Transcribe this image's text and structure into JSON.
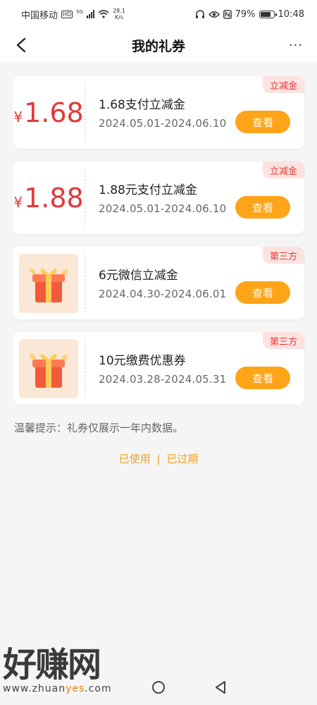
{
  "statusbar": {
    "carrier": "中国移动",
    "hd": "HD",
    "signal": "5G",
    "net_speed_value": "28.1",
    "net_speed_unit": "K/s",
    "battery": "79%",
    "battery_level": 0.79,
    "time": "10:48"
  },
  "navbar": {
    "title": "我的礼券",
    "more": "···"
  },
  "coupons": [
    {
      "currency": "¥",
      "amount": "1.68",
      "title": "1.68支付立减金",
      "dates": "2024.05.01-2024.06.10",
      "button": "查看",
      "tag": "立减金",
      "image": ""
    },
    {
      "currency": "¥",
      "amount": "1.88",
      "title": "1.88元支付立减金",
      "dates": "2024.05.01-2024.06.10",
      "button": "查看",
      "tag": "立减金",
      "image": ""
    },
    {
      "currency": "",
      "amount": "",
      "title": "6元微信立减金",
      "dates": "2024.04.30-2024.06.01",
      "button": "查看",
      "tag": "第三方",
      "image": "gift-box-icon"
    },
    {
      "currency": "",
      "amount": "",
      "title": "10元缴费优惠券",
      "dates": "2024.03.28-2024.05.31",
      "button": "查看",
      "tag": "第三方",
      "image": "gift-box-icon"
    }
  ],
  "notice": "温馨提示：礼券仅展示一年内数据。",
  "links": {
    "used": "已使用",
    "separator": "|",
    "expired": "已过期"
  },
  "watermark": {
    "big": "好赚网",
    "url_prefix": "www.zhuan",
    "url_highlight": "yes",
    "url_suffix": ".com"
  },
  "colors": {
    "accent": "#fea418",
    "amount": "#e03a3a",
    "tag_bg": "#fde2e0",
    "tag_text": "#e23b35"
  }
}
